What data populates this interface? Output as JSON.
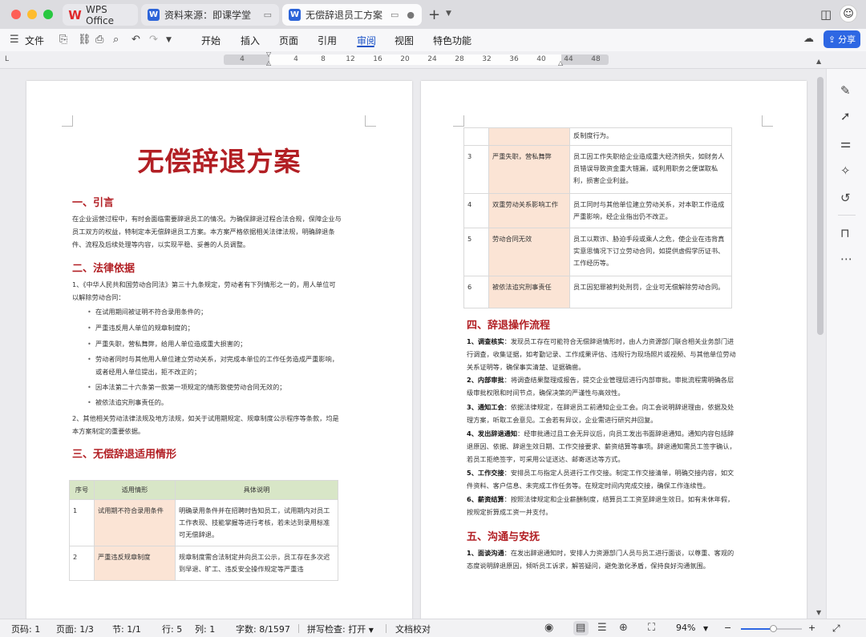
{
  "tabs": [
    {
      "label": "WPS Office",
      "logo": "W"
    },
    {
      "label": "资料来源：即课学堂",
      "logo": "W"
    },
    {
      "label": "无偿辞退员工方案",
      "logo": "W"
    }
  ],
  "menu": {
    "file": "文件",
    "items": [
      "开始",
      "插入",
      "页面",
      "引用",
      "审阅",
      "视图",
      "特色功能"
    ],
    "active": "审阅",
    "share": "分享"
  },
  "ruler": {
    "ticks": [
      "4",
      "4",
      "8",
      "12",
      "16",
      "20",
      "24",
      "28",
      "32",
      "36",
      "40",
      "44",
      "48"
    ]
  },
  "doc": {
    "title": "无偿辞退方案",
    "s1": {
      "heading": "一、引言",
      "lines": [
        "在企业运营过程中，有时会面临需要辞退员工的情况。为确保辞退过程合法合规，保障企业与",
        "员工双方的权益，特制定本无偿辞退员工方案。本方案严格依据相关法律法规，明确辞退条",
        "件、流程及后续处理等内容，以实现平稳、妥善的人员调整。"
      ]
    },
    "s2": {
      "heading": "二、法律依据",
      "item1": [
        "1、《中华人民共和国劳动合同法》第三十九条规定，劳动者有下列情形之一的，用人单位可",
        "以解除劳动合同："
      ],
      "bullets": [
        "在试用期间被证明不符合录用条件的；",
        "严重违反用人单位的规章制度的；",
        "严重失职，营私舞弊，给用人单位造成重大损害的；",
        "劳动者同时与其他用人单位建立劳动关系，对完成本单位的工作任务造成严重影响，",
        "或者经用人单位提出，拒不改正的；",
        "因本法第二十六条第一款第一项规定的情形致使劳动合同无效的；",
        "被依法追究刑事责任的。"
      ],
      "item2": [
        "2、其他相关劳动法律法规及地方法规，如关于试用期规定、规章制度公示程序等条款，均是",
        "本方案制定的重要依据。"
      ]
    },
    "s3": {
      "heading": "三、无偿辞退适用情形",
      "headers": [
        "序号",
        "适用情形",
        "具体说明"
      ],
      "rows": [
        {
          "no": "1",
          "cat": "试用期不符合录用条件",
          "desc": "明确录用条件并在招聘时告知员工，试用期内对员工工作表现、技能掌握等进行考核，若未达到录用标准可无偿辞退。"
        },
        {
          "no": "2",
          "cat": "严重违反规章制度",
          "desc": "规章制度需合法制定并向员工公示，员工存在多次迟到早退、旷工、违反安全操作规定等严重违"
        }
      ]
    },
    "right_table": {
      "cont": "反制度行为。",
      "rows": [
        {
          "no": "3",
          "cat": "严重失职，营私舞弊",
          "desc": "员工因工作失职给企业造成重大经济损失，如财务人员错误导致资金重大错漏，或利用职务之便谋取私利，损害企业利益。"
        },
        {
          "no": "4",
          "cat": "双重劳动关系影响工作",
          "desc": "员工同时与其他单位建立劳动关系，对本职工作造成严重影响，经企业指出仍不改正。"
        },
        {
          "no": "5",
          "cat": "劳动合同无效",
          "desc": "员工以欺诈、胁迫手段或乘人之危，使企业在违背真实意思情况下订立劳动合同，如提供虚假学历证书、工作经历等。"
        },
        {
          "no": "6",
          "cat": "被依法追究刑事责任",
          "desc": "员工因犯罪被判处刑罚，企业可无偿解除劳动合同。"
        }
      ]
    },
    "s4": {
      "heading": "四、辞退操作流程",
      "steps": [
        {
          "bold": "1、调查核实",
          "lines": [
            "：发现员工存在可能符合无偿辞退情形时，由人力资源部门联合相关业务部门进",
            "行调查，收集证据，如考勤记录、工作成果评估、违规行为现场照片或视频、与其他单位劳动",
            "关系证明等，确保事实清楚、证据确凿。"
          ]
        },
        {
          "bold": "2、内部审批",
          "lines": [
            "：将调查结果整理成报告，提交企业管理层进行内部审批。审批流程需明确各层",
            "级审批权限和时间节点，确保决策的严谨性与高效性。"
          ]
        },
        {
          "bold": "3、通知工会",
          "lines": [
            "：依据法律规定，在辞退员工前通知企业工会。向工会说明辞退理由，依据及处",
            "理方案，听取工会意见。工会若有异议，企业需进行研究并回复。"
          ]
        },
        {
          "bold": "4、发出辞退通知",
          "lines": [
            "：经审批通过且工会无异议后，向员工发出书面辞退通知。通知内容包括辞",
            "退原因、依据、辞退生效日期、工作交接要求、薪资结算等事项。辞退通知需员工签字确认，",
            "若员工拒绝签字，可采用公证送达、邮寄送达等方式。"
          ]
        },
        {
          "bold": "5、工作交接",
          "lines": [
            "：安排员工与指定人员进行工作交接。制定工作交接清单，明确交接内容，如文",
            "件资料、客户信息、未完成工作任务等。在规定时间内完成交接，确保工作连续性。"
          ]
        },
        {
          "bold": "6、薪资结算",
          "lines": [
            "：按照法律规定和企业薪酬制度，结算员工工资至辞退生效日。如有未休年假，",
            "按规定折算成工资一并支付。"
          ]
        }
      ]
    },
    "s5": {
      "heading": "五、沟通与安抚",
      "steps": [
        {
          "bold": "1、面谈沟通",
          "lines": [
            "：在发出辞退通知时，安排人力资源部门人员与员工进行面谈，以尊重、客观的",
            "态度说明辞退原因，倾听员工诉求，解答疑问，避免激化矛盾，保持良好沟通氛围。"
          ]
        }
      ]
    }
  },
  "status": {
    "page_no": "页码: 1",
    "pages": "页面: 1/3",
    "section": "节: 1/1",
    "row": "行: 5",
    "col": "列: 1",
    "words": "字数: 8/1597",
    "spell": "拼写检查: 打开",
    "proof": "文档校对",
    "zoom": "94%"
  },
  "colors": {
    "heading": "#b21f24",
    "accent": "#2e67e3",
    "table_header": "#d8e6c7",
    "table_category": "#fbe4d5"
  }
}
